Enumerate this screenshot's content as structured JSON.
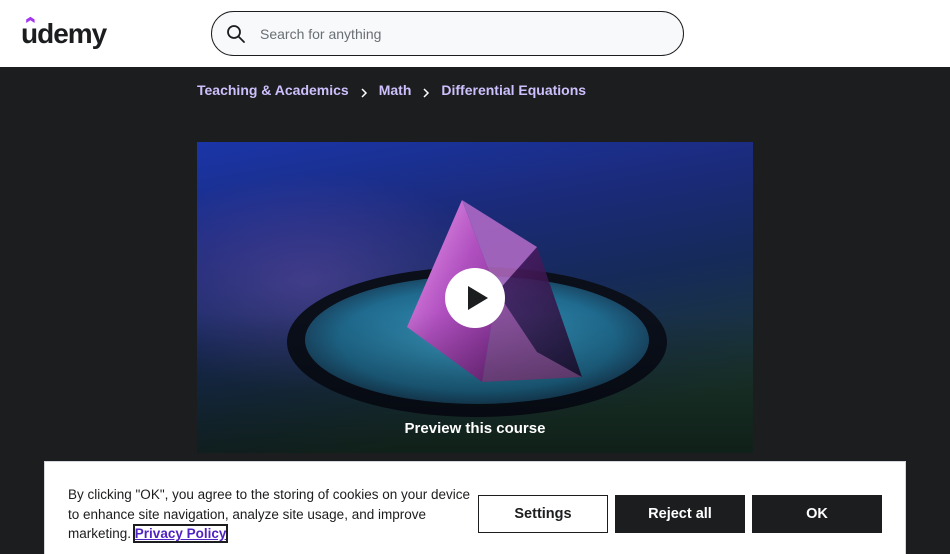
{
  "header": {
    "logo_text": "ûdemy",
    "search": {
      "placeholder": "Search for anything",
      "value": "",
      "icon": "search-icon"
    }
  },
  "breadcrumb": {
    "items": [
      {
        "label": "Teaching & Academics"
      },
      {
        "label": "Math"
      },
      {
        "label": "Differential Equations"
      }
    ],
    "separator_icon": "chevron-right-icon"
  },
  "preview": {
    "label": "Preview this course",
    "icon": "play-icon"
  },
  "cookie_banner": {
    "text": "By clicking \"OK\", you agree to the storing of cookies on your device to enhance site navigation, analyze site usage, and improve marketing.",
    "link_label": "Privacy Policy",
    "buttons": {
      "settings": "Settings",
      "reject": "Reject all",
      "ok": "OK"
    }
  },
  "colors": {
    "brand_purple": "#a435f0",
    "link_lavender": "#cec0fc",
    "dark_bg": "#1c1d1f",
    "privacy_link": "#5022c3"
  }
}
